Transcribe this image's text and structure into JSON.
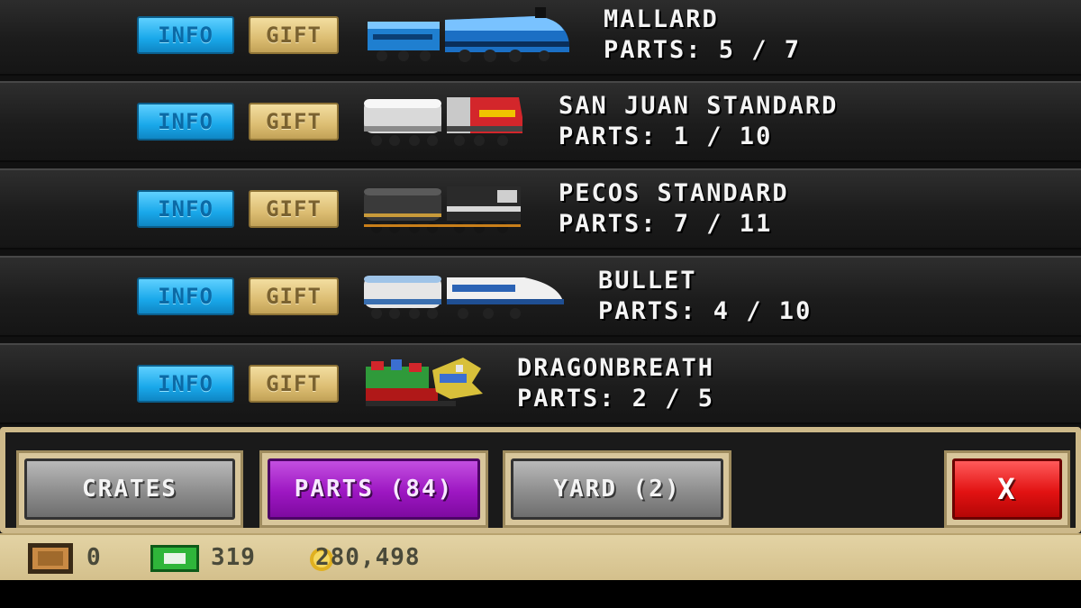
{
  "buttons": {
    "info_label": "INFO",
    "gift_label": "GIFT"
  },
  "trains": [
    {
      "name": "MALLARD",
      "parts": "PARTS: 5 / 7"
    },
    {
      "name": "SAN JUAN STANDARD",
      "parts": "PARTS: 1 / 10"
    },
    {
      "name": "PECOS STANDARD",
      "parts": "PARTS: 7 / 11"
    },
    {
      "name": "BULLET",
      "parts": "PARTS: 4 / 10"
    },
    {
      "name": "DRAGONBREATH",
      "parts": "PARTS: 2 / 5"
    }
  ],
  "tabs": {
    "crates": "CRATES",
    "parts": "PARTS (84)",
    "yard": "YARD (2)",
    "close": "X"
  },
  "status": {
    "crates_count": "0",
    "cash": "319",
    "coins": "280,498"
  },
  "colors": {
    "info": "#19a8ea",
    "gift": "#dcbd72",
    "active_tab": "#9d17c2",
    "close": "#e21212",
    "frame": "#cdb98a"
  }
}
